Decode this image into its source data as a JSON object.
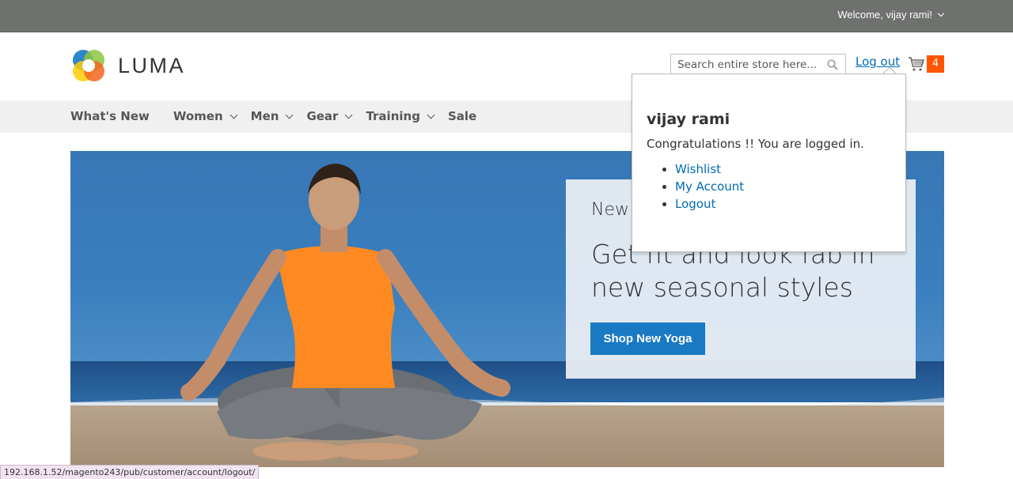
{
  "top_bar": {
    "welcome": "Welcome, vijay rami!"
  },
  "header": {
    "logo_text": "LUMA",
    "search_placeholder": "Search entire store here...",
    "logout_label": "Log out",
    "cart_count": "4"
  },
  "nav": {
    "items": [
      {
        "label": "What's New",
        "has_submenu": false
      },
      {
        "label": "Women",
        "has_submenu": true
      },
      {
        "label": "Men",
        "has_submenu": true
      },
      {
        "label": "Gear",
        "has_submenu": true
      },
      {
        "label": "Training",
        "has_submenu": true
      },
      {
        "label": "Sale",
        "has_submenu": false
      }
    ]
  },
  "hero": {
    "promo_small": "New",
    "promo_headline": "Get fit and look fab in new seasonal styles",
    "promo_button": "Shop New Yoga"
  },
  "account_dropdown": {
    "name": "vijay rami",
    "message": "Congratulations !! You are logged in.",
    "links": [
      "Wishlist",
      "My Account",
      "Logout"
    ]
  },
  "status_bar": {
    "url": "192.168.1.52/magento243/pub/customer/account/logout/"
  },
  "colors": {
    "top_bar": "#6e716e",
    "link": "#006bb4",
    "button": "#1979c3",
    "cart_badge": "#ff5501",
    "nav_bg": "#f0f0f0"
  },
  "icons": [
    "chevron-down-icon",
    "search-icon",
    "cart-icon",
    "luma-logo-icon"
  ]
}
